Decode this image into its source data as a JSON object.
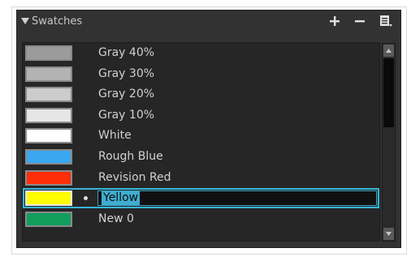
{
  "panel": {
    "title": "Swatches",
    "icons": {
      "add": "plus-icon",
      "remove": "minus-icon",
      "menu": "menu-icon"
    }
  },
  "swatches": [
    {
      "label": "Gray 40%",
      "color": "#9b9b9b"
    },
    {
      "label": "Gray 30%",
      "color": "#b3b3b3"
    },
    {
      "label": "Gray 20%",
      "color": "#cccccc"
    },
    {
      "label": "Gray 10%",
      "color": "#e6e6e6"
    },
    {
      "label": "White",
      "color": "#ffffff"
    },
    {
      "label": "Rough Blue",
      "color": "#39a7f1"
    },
    {
      "label": "Revision Red",
      "color": "#ff2d09"
    },
    {
      "label": "Yellow",
      "color": "#fffd00",
      "selected": true,
      "editing": true
    },
    {
      "label": "New 0",
      "color": "#119e5c"
    }
  ],
  "colors": {
    "selection_outline": "#35b6d8",
    "text_highlight": "#3eaed0"
  }
}
